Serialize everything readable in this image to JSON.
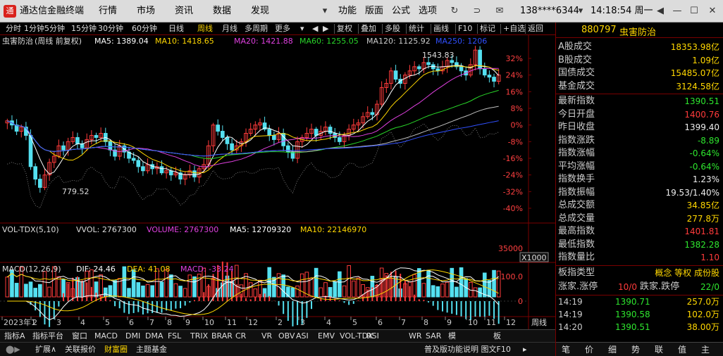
{
  "title_bar": {
    "app_name": "通达信金融终端",
    "menus": [
      "行情",
      "市场",
      "资讯",
      "数据",
      "发现"
    ],
    "menus_right": [
      "功能",
      "版面",
      "公式",
      "选项"
    ],
    "account": "138****6344",
    "time": "14:18:54 周一"
  },
  "toolbar": {
    "periods": [
      "分时",
      "1分钟",
      "5分钟",
      "15分钟",
      "30分钟",
      "60分钟",
      "日线",
      "周线",
      "月线",
      "多周期",
      "更多"
    ],
    "active_period": "周线",
    "tools": [
      "复权",
      "叠加",
      "多股",
      "统计",
      "画线",
      "F10",
      "标记",
      "+自选",
      "返回"
    ]
  },
  "chart_header": {
    "name": "虫害防治",
    "mode": "(周线 前复权)",
    "ma5": "MA5: 1389.04",
    "ma10": "MA10: 1418.65",
    "ma20": "MA20: 1421.88",
    "ma60": "MA60: 1255.05",
    "ma120": "MA120: 1125.92",
    "ma250": "MA250: 1206"
  },
  "price_labels": {
    "high": "1543.83",
    "low": "779.52"
  },
  "y_axis_pct": [
    "32%",
    "24%",
    "16%",
    "8%",
    "0%",
    "-8%",
    "-16%",
    "-24%",
    "-32%",
    "-40%"
  ],
  "vol_header": {
    "name": "VOL-TDX(5,10)",
    "vvol": "VVOL: 2767300",
    "volume": "VOLUME: 2767300",
    "ma5": "MA5: 12709320",
    "ma10": "MA10: 22146970"
  },
  "vol_axis": {
    "tick": "35000",
    "unit": "X1000"
  },
  "macd_header": {
    "name": "MACD(12,26,9)",
    "dif": "DIF: 24.46",
    "dea": "DEA: 41.08",
    "macd": "MACD: -33.24"
  },
  "macd_axis": {
    "tick": "100.0",
    "zero": "0"
  },
  "time_axis": {
    "labels": [
      "2023年1",
      "2",
      "3",
      "4",
      "5",
      "6",
      "7",
      "8",
      "9",
      "10",
      "11",
      "12",
      "2",
      "3",
      "4",
      "5",
      "6",
      "7",
      "8",
      "9",
      "10",
      "11",
      "12"
    ],
    "corner": "周线"
  },
  "indicator_tabs": [
    "指标A",
    "指标平台",
    "窗口",
    "MACD",
    "DMI",
    "DMA",
    "FSL",
    "TRIX",
    "BRAR",
    "CR",
    "VR",
    "OBV",
    "ASI",
    "EMV",
    "VOL-TDX",
    "RSI",
    "WR",
    "SAR",
    "模",
    "板"
  ],
  "bottom_tabs": [
    "扩展∧",
    "关联报价",
    "财富圈",
    "主题基金"
  ],
  "bottom_active": "财富圈",
  "bottom_right": "普及版功能说明 图文F10",
  "right_panel": {
    "code": "880797",
    "name": "虫害防治",
    "turnover": [
      {
        "label": "A股成交",
        "value": "18353.98亿"
      },
      {
        "label": "B股成交",
        "value": "1.09亿"
      },
      {
        "label": "国债成交",
        "value": "15485.07亿"
      },
      {
        "label": "基金成交",
        "value": "3124.58亿"
      }
    ],
    "stats": [
      {
        "label": "最新指数",
        "value": "1390.51",
        "color": "green"
      },
      {
        "label": "今日开盘",
        "value": "1400.76",
        "color": "red"
      },
      {
        "label": "昨日收盘",
        "value": "1399.40",
        "color": "white"
      },
      {
        "label": "指数涨跌",
        "value": "-8.89",
        "color": "green"
      },
      {
        "label": "指数涨幅",
        "value": "-0.64%",
        "color": "green"
      },
      {
        "label": "平均涨幅",
        "value": "-0.64%",
        "color": "green"
      },
      {
        "label": "指数换手",
        "value": "1.23%",
        "color": "white"
      },
      {
        "label": "指数振幅",
        "value": "19.53/1.40%",
        "color": "white"
      },
      {
        "label": "总成交额",
        "value": "34.85亿",
        "color": "yellow"
      },
      {
        "label": "总成交量",
        "value": "277.8万",
        "color": "yellow"
      },
      {
        "label": "最高指数",
        "value": "1401.81",
        "color": "red"
      },
      {
        "label": "最低指数",
        "value": "1382.28",
        "color": "green"
      },
      {
        "label": "指数量比",
        "value": "1.10",
        "color": "red"
      }
    ],
    "type_label": "板指类型",
    "type_value": "概念 等权 成份股",
    "updown": "涨家.涨停",
    "updown_val": "10/0",
    "downs": "跌家.跌停",
    "downs_val": "22/0",
    "ticks": [
      {
        "time": "14:19",
        "price": "1390.71",
        "vol": "257.0万"
      },
      {
        "time": "14:19",
        "price": "1390.58",
        "vol": "102.0万"
      },
      {
        "time": "14:20",
        "price": "1390.51",
        "vol": "38.00万"
      }
    ],
    "tabs": [
      "笔",
      "价",
      "细",
      "势",
      "联",
      "值",
      "主"
    ]
  },
  "colors": {
    "up": "#ff3b3b",
    "down": "#54e0f0",
    "ma5": "#ffffff",
    "ma10": "#ffd700",
    "ma20": "#e040e0",
    "ma60": "#29d629",
    "ma120": "#c0c0c0",
    "ma250": "#3050ff",
    "bg": "#000000",
    "frame": "#7a0000"
  }
}
